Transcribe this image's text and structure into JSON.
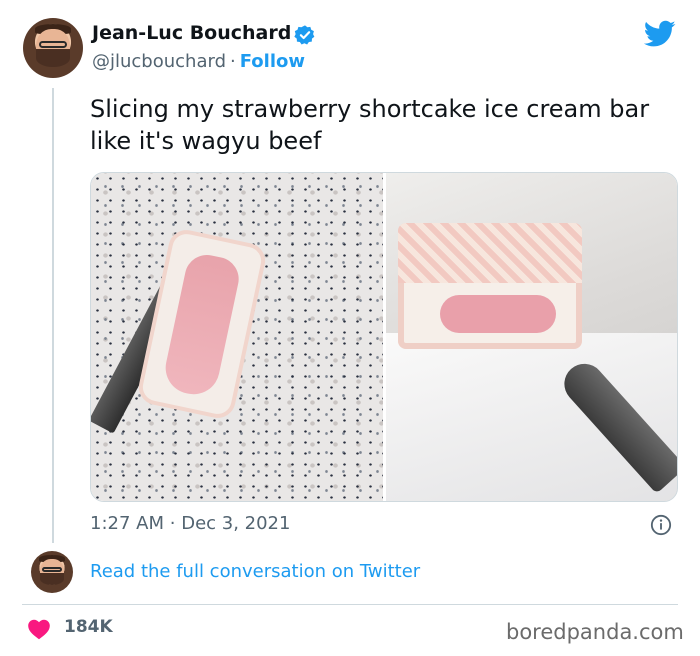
{
  "tweet": {
    "author_name": "Jean-Luc Bouchard",
    "handle": "@jlucbouchard",
    "separator": "·",
    "follow_label": "Follow",
    "text": "Slicing my strawberry shortcake ice cream bar like it's wagyu beef",
    "time": "1:27 AM",
    "date": "Dec 3, 2021",
    "read_conversation_label": "Read the full conversation on Twitter",
    "likes_count": "184K"
  },
  "watermark": "boredpanda.com",
  "icons": {
    "verified": "verified-badge-icon",
    "brand": "twitter-bird-icon",
    "info": "info-icon",
    "like": "heart-icon"
  },
  "colors": {
    "accent": "#1d9bf0",
    "text_primary": "#0f1419",
    "text_secondary": "#536471",
    "like": "#f91880",
    "border": "#cfd9de"
  }
}
